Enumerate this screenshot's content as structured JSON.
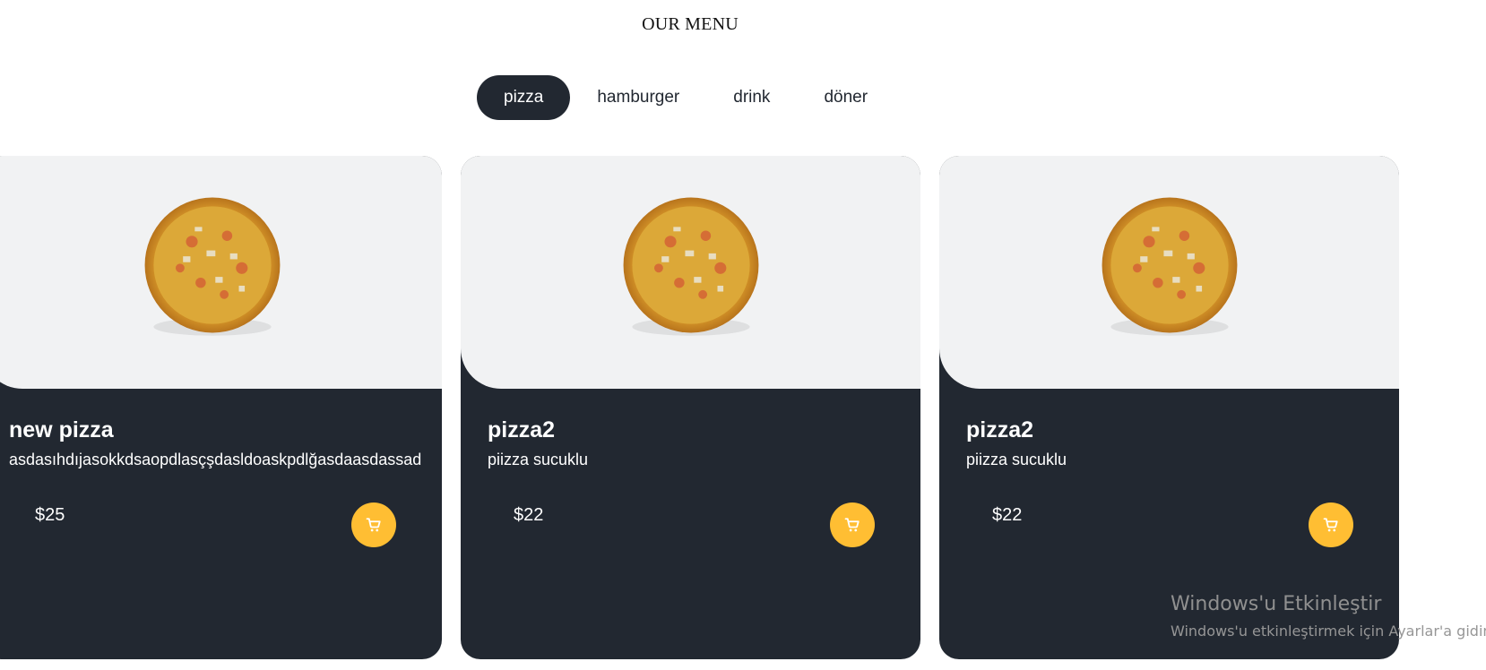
{
  "page": {
    "title": "OUR MENU"
  },
  "tabs": [
    {
      "label": "pizza",
      "active": true
    },
    {
      "label": "hamburger",
      "active": false
    },
    {
      "label": "drink",
      "active": false
    },
    {
      "label": "döner",
      "active": false
    }
  ],
  "products": [
    {
      "name": "new pizza",
      "description": "asdasıhdıjasokkdsaopdlasçşdasldoaskpdlğasdaasdassad",
      "price": "$25"
    },
    {
      "name": "pizza2",
      "description": "piizza sucuklu",
      "price": "$22"
    },
    {
      "name": "pizza2",
      "description": "piizza sucuklu",
      "price": "$22"
    }
  ],
  "icons": {
    "cart": "cart-icon",
    "product_image": "pizza-image"
  },
  "colors": {
    "dark": "#222831",
    "accent": "#ffbe33",
    "image_bg": "#f1f2f3"
  },
  "watermark": {
    "line1": "Windows'u Etkinleştir",
    "line2": "Windows'u etkinleştirmek için Ayarlar'a gidin."
  }
}
